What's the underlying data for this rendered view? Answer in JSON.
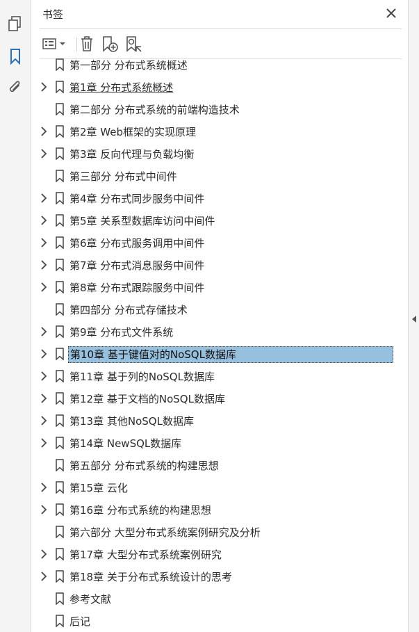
{
  "panel": {
    "title": "书签"
  },
  "rail": {
    "icons": [
      "pages-icon",
      "bookmark-icon",
      "attachment-icon"
    ]
  },
  "toolbar": {
    "icons": [
      "options-menu-icon",
      "delete-icon",
      "new-bookmark-icon",
      "find-bookmark-icon"
    ]
  },
  "bookmarks": [
    {
      "label": "第一部分 分布式系统概述",
      "expandable": false,
      "state": "partial"
    },
    {
      "label": "第1章 分布式系统概述",
      "expandable": true,
      "state": "underline"
    },
    {
      "label": "第二部分 分布式系统的前端构造技术",
      "expandable": false
    },
    {
      "label": "第2章 Web框架的实现原理",
      "expandable": true
    },
    {
      "label": "第3章 反向代理与负载均衡",
      "expandable": true
    },
    {
      "label": "第三部分 分布式中间件",
      "expandable": false
    },
    {
      "label": "第4章 分布式同步服务中间件",
      "expandable": true
    },
    {
      "label": "第5章 关系型数据库访问中间件",
      "expandable": true
    },
    {
      "label": "第6章 分布式服务调用中间件",
      "expandable": true
    },
    {
      "label": "第7章 分布式消息服务中间件",
      "expandable": true
    },
    {
      "label": "第8章 分布式跟踪服务中间件",
      "expandable": true
    },
    {
      "label": "第四部分 分布式存储技术",
      "expandable": false
    },
    {
      "label": "第9章 分布式文件系统",
      "expandable": true
    },
    {
      "label": "第10章 基于键值对的NoSQL数据库",
      "expandable": true,
      "state": "selected"
    },
    {
      "label": "第11章 基于列的NoSQL数据库",
      "expandable": true
    },
    {
      "label": "第12章 基于文档的NoSQL数据库",
      "expandable": true
    },
    {
      "label": "第13章 其他NoSQL数据库",
      "expandable": true
    },
    {
      "label": "第14章 NewSQL数据库",
      "expandable": true
    },
    {
      "label": "第五部分 分布式系统的构建思想",
      "expandable": false
    },
    {
      "label": "第15章 云化",
      "expandable": true
    },
    {
      "label": "第16章 分布式系统的构建思想",
      "expandable": true
    },
    {
      "label": "第六部分 大型分布式系统案例研究及分析",
      "expandable": false
    },
    {
      "label": "第17章 大型分布式系统案例研究",
      "expandable": true
    },
    {
      "label": "第18章 关于分布式系统设计的思考",
      "expandable": true
    },
    {
      "label": "参考文献",
      "expandable": false
    },
    {
      "label": "后记",
      "expandable": false
    }
  ],
  "colors": {
    "selection": "#97c0de",
    "accent": "#2d6fb5",
    "icon": "#555555"
  }
}
